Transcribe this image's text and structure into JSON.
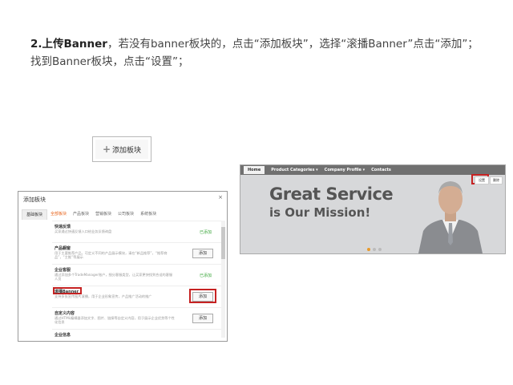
{
  "instruction": {
    "step": "2.上传Banner",
    "text": "，若没有banner板块的，点击“添加板块”，选择“滚播Banner”点击“添加”；找到Banner板块，点击“设置”；"
  },
  "add_block_button": {
    "label": "添加板块"
  },
  "dialog": {
    "title": "添加板块",
    "close": "×",
    "side_tab": "基础板块",
    "tabs": [
      "全部板块",
      "产品板块",
      "营销板块",
      "公司板块",
      "系统板块"
    ],
    "items": [
      {
        "name": "快速反馈",
        "desc": "买家通过快速反馈入口给业务反馈询盘",
        "state": "已添加",
        "action": ""
      },
      {
        "name": "产品橱窗",
        "desc": "用于主要推荐产品，可定义不同的产品展示模块，请在“新品推荐”，“推荐商品”，“主推”等展示",
        "state": "",
        "action": "添加"
      },
      {
        "name": "企业客服",
        "desc": "通过添加多个TradeManager账户，细分客服类型，让买家更快找到合适的客服人员",
        "state": "已添加",
        "action": ""
      },
      {
        "name": "滚播Banner",
        "desc": "支持多张宣传图片滚播，用于企业形象宣传，产品推广活动的推广",
        "state": "",
        "action": "添加"
      },
      {
        "name": "自定义内容",
        "desc": "通过HTML编辑器添加文字、图片、链接等自定义内容，用于展示企业优势等个性化信息",
        "state": "",
        "action": "添加"
      },
      {
        "name": "企业信息",
        "desc": "",
        "state": "",
        "action": ""
      }
    ]
  },
  "preview": {
    "nav": [
      "Home",
      "Product Categories ▾",
      "Company Profile ▾",
      "Contacts"
    ],
    "headline": "Great Service",
    "subheadline": "is Our Mission!",
    "settings_label": "设置",
    "delete_label": "删除"
  },
  "colors": {
    "highlight": "#c62222",
    "active_tab": "#e8641b",
    "added": "#3aa63a"
  }
}
